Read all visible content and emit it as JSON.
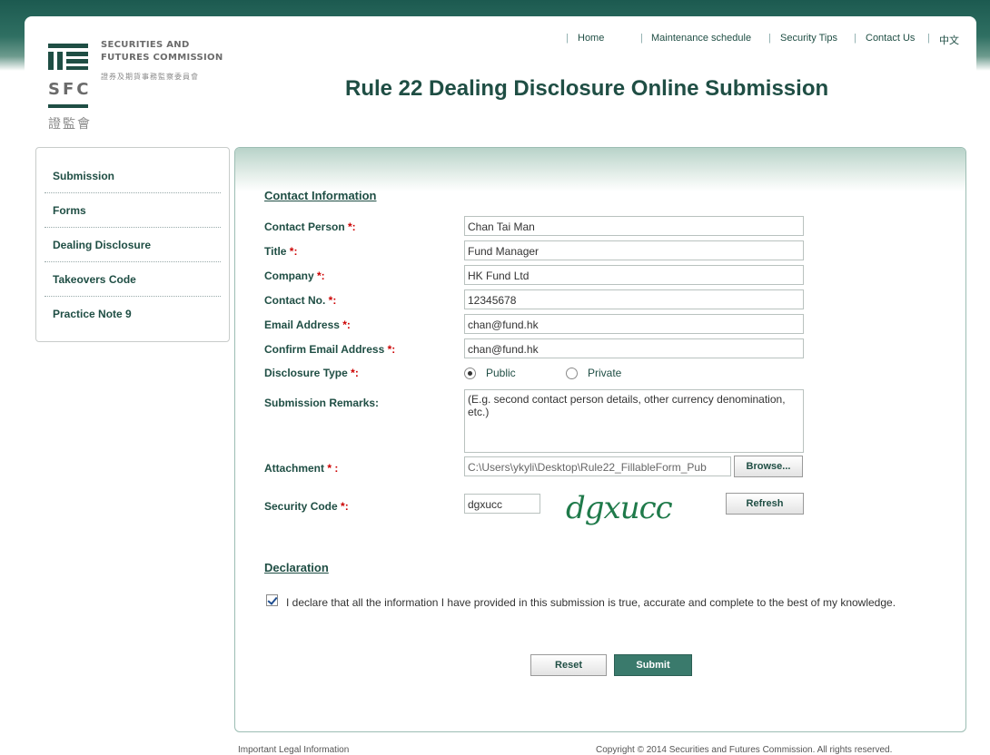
{
  "logo": {
    "line1": "SECURITIES AND",
    "line2": "FUTURES COMMISSION",
    "chinese_name": "證券及期貨事務監察委員會",
    "abbr": "SFC",
    "chinese_short": "證監會"
  },
  "topnav": {
    "items": [
      "Home",
      "Maintenance schedule",
      "Security Tips",
      "Contact Us",
      "中文"
    ]
  },
  "page_title": "Rule 22 Dealing Disclosure Online Submission",
  "sidebar": {
    "items": [
      "Submission",
      "Forms",
      "Dealing Disclosure",
      "Takeovers Code",
      "Practice Note 9"
    ]
  },
  "contact": {
    "heading": "Contact Information",
    "required_mark": "*:",
    "fields": {
      "contact_person": {
        "label": "Contact Person ",
        "value": "Chan Tai Man"
      },
      "title": {
        "label": "Title ",
        "value": "Fund Manager"
      },
      "company": {
        "label": "Company ",
        "value": "HK Fund Ltd"
      },
      "contact_no": {
        "label": "Contact No. ",
        "value": "12345678"
      },
      "email": {
        "label": "Email Address ",
        "value": "chan@fund.hk"
      },
      "confirm_email": {
        "label": "Confirm Email Address ",
        "value": "chan@fund.hk"
      }
    },
    "disclosure_type": {
      "label": "Disclosure Type ",
      "options": [
        "Public",
        "Private"
      ],
      "selected": "Public"
    },
    "remarks": {
      "label": "Submission Remarks:",
      "placeholder": "(E.g. second contact person details, other currency denomination, etc.)"
    },
    "attachment": {
      "label": "Attachment ",
      "required_mark": "* :",
      "value": "C:\\Users\\ykyli\\Desktop\\Rule22_FillableForm_Pub",
      "browse_label": "Browse..."
    },
    "security": {
      "label": "Security Code ",
      "value": "dgxucc",
      "captcha_text": "dgxucc",
      "refresh_label": "Refresh"
    }
  },
  "declaration": {
    "heading": "Declaration",
    "text": "I declare that all the information I have provided in this submission is true, accurate and complete to the best of my knowledge.",
    "checked": true
  },
  "actions": {
    "reset_label": "Reset",
    "submit_label": "Submit"
  },
  "footer": {
    "legal": "Important Legal Information",
    "copyright": "Copyright © 2014 Securities and Futures Commission. All rights reserved."
  },
  "colors": {
    "brand": "#1f4e44",
    "required": "#cc0000",
    "submit_button": "#3a7a6c"
  }
}
